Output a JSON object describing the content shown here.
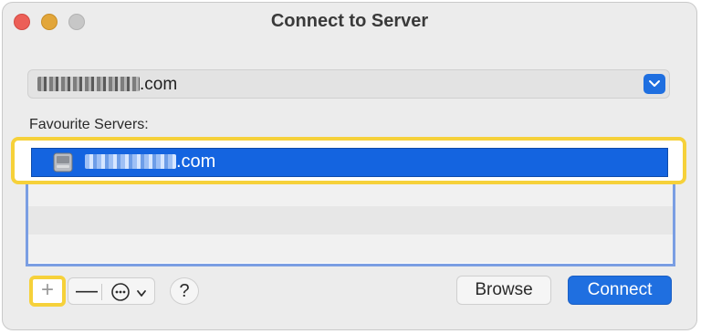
{
  "window": {
    "title": "Connect to Server"
  },
  "address": {
    "value_suffix": ".com"
  },
  "favourites": {
    "label": "Favourite Servers:",
    "items": [
      {
        "label_suffix": ".com",
        "selected": true
      }
    ]
  },
  "toolbar": {
    "add_label": "+",
    "remove_label": "—",
    "help_label": "?"
  },
  "buttons": {
    "browse": "Browse",
    "connect": "Connect"
  },
  "colors": {
    "accent": "#1f6fe0",
    "highlight": "#f6d13a",
    "selection": "#1464e0"
  },
  "icons": {
    "dropdown": "chevron-down-icon",
    "server": "server-drive-icon",
    "more": "ellipsis-circle-icon"
  }
}
